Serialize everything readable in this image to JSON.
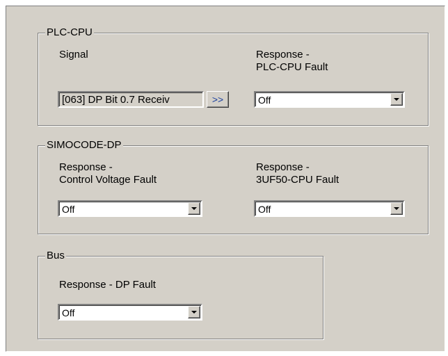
{
  "groups": {
    "plc_cpu": {
      "legend": "PLC-CPU",
      "signal_label": "Signal",
      "signal_value": "[063] DP Bit 0.7 Receiv",
      "more_button": ">>",
      "response_label_1": "Response -",
      "response_label_2": "PLC-CPU Fault",
      "response_value": "Off"
    },
    "simocode_dp": {
      "legend": "SIMOCODE-DP",
      "cv_label_1": "Response -",
      "cv_label_2": "Control Voltage Fault",
      "cv_value": "Off",
      "cpu_label_1": "Response -",
      "cpu_label_2": "3UF50-CPU Fault",
      "cpu_value": "Off"
    },
    "bus": {
      "legend": "Bus",
      "dp_label": "Response - DP Fault",
      "dp_value": "Off"
    }
  }
}
